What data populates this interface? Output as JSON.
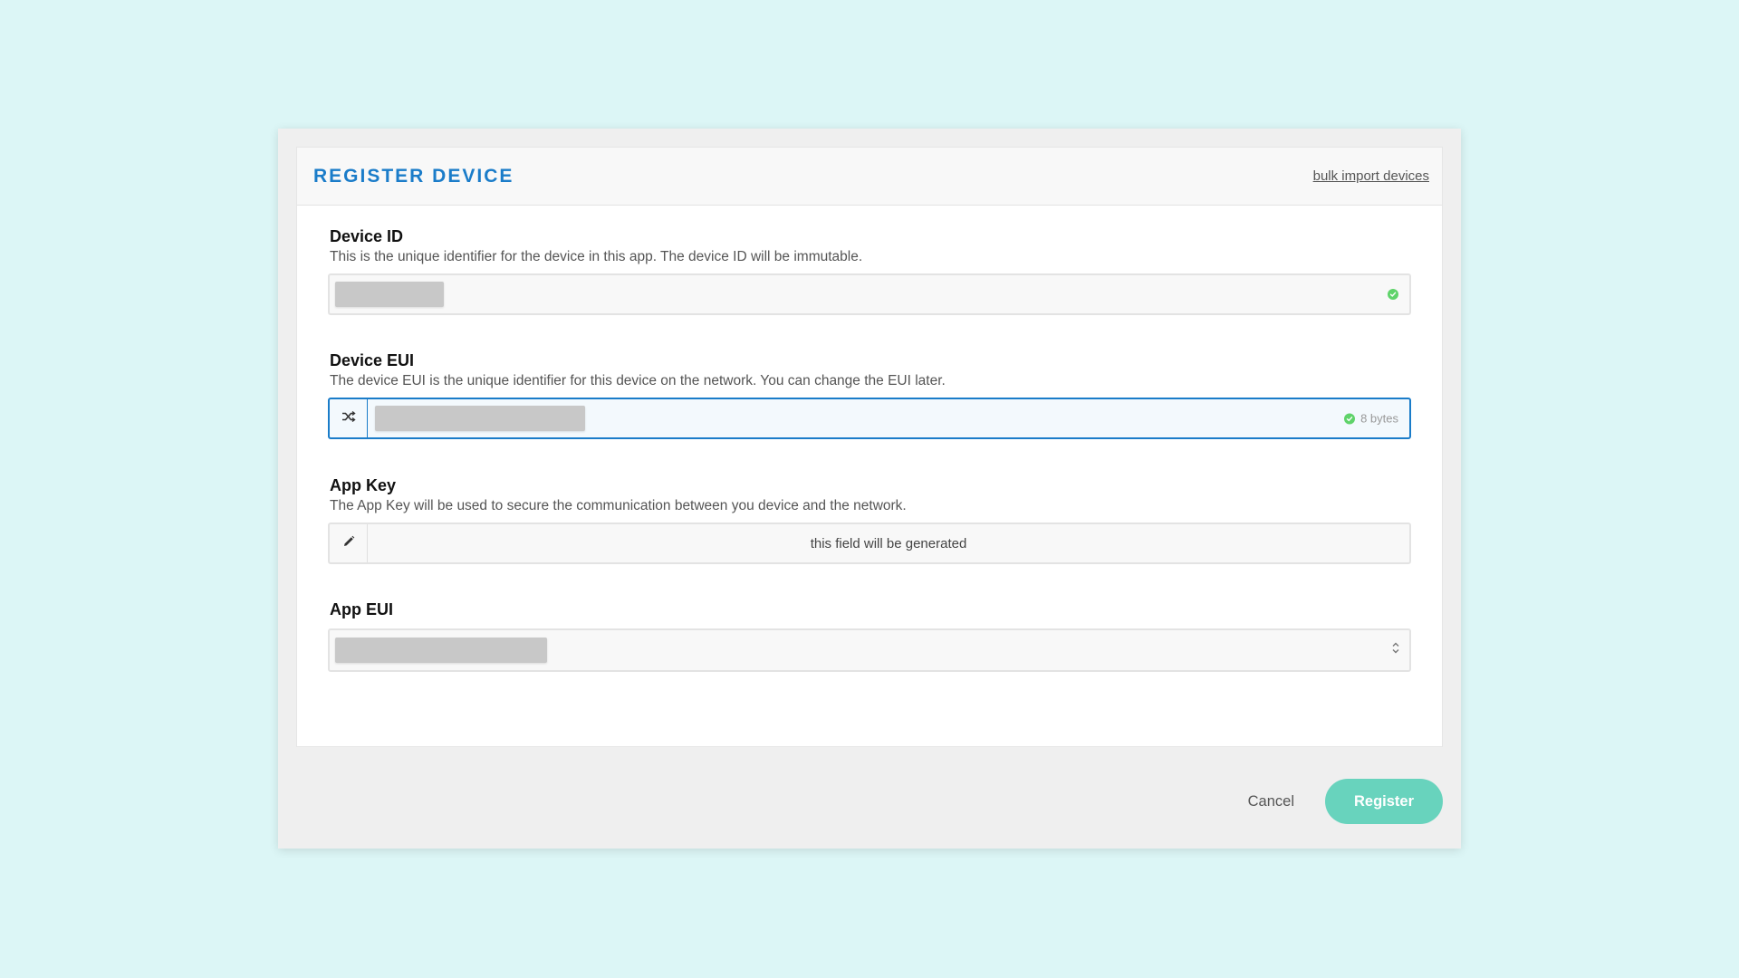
{
  "dialog": {
    "title": "REGISTER DEVICE",
    "bulk_import_label": "bulk import devices"
  },
  "fields": {
    "device_id": {
      "label": "Device ID",
      "description": "This is the unique identifier for the device in this app. The device ID will be immutable.",
      "value_redacted": true,
      "valid": true
    },
    "device_eui": {
      "label": "Device EUI",
      "description": "The device EUI is the unique identifier for this device on the network. You can change the EUI later.",
      "value_redacted": true,
      "valid": true,
      "size_hint": "8 bytes",
      "focused": true
    },
    "app_key": {
      "label": "App Key",
      "description": "The App Key will be used to secure the communication between you device and the network.",
      "generated_text": "this field will be generated"
    },
    "app_eui": {
      "label": "App EUI",
      "value_redacted": true
    }
  },
  "actions": {
    "cancel_label": "Cancel",
    "register_label": "Register"
  },
  "colors": {
    "accent": "#1a7cc9",
    "register_button": "#68d3bd",
    "valid": "#5fd36a",
    "background": "#dcf6f6"
  },
  "icons": {
    "device_eui_prefix": "shuffle-icon",
    "app_key_prefix": "pencil-icon",
    "app_eui_select": "select-arrows-icon",
    "valid": "check-circle-icon"
  }
}
